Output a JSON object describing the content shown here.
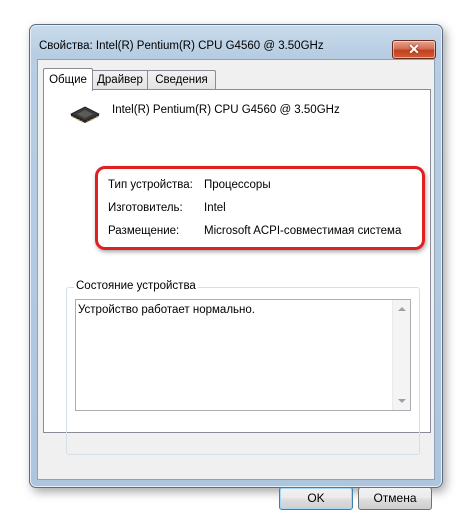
{
  "window": {
    "title": "Свойства: Intel(R) Pentium(R) CPU G4560 @ 3.50GHz",
    "close_glyph": "✕"
  },
  "tabs": [
    {
      "label": "Общие",
      "active": true
    },
    {
      "label": "Драйвер",
      "active": false
    },
    {
      "label": "Сведения",
      "active": false
    }
  ],
  "general": {
    "icon": "cpu-chip-icon",
    "device_name": "Intel(R) Pentium(R) CPU G4560 @ 3.50GHz",
    "properties": [
      {
        "label": "Тип устройства:",
        "value": "Процессоры"
      },
      {
        "label": "Изготовитель:",
        "value": "Intel"
      },
      {
        "label": "Размещение:",
        "value": "Microsoft ACPI-совместимая система"
      }
    ],
    "highlight_color": "#e02020"
  },
  "status": {
    "group_label": "Состояние устройства",
    "text": "Устройство работает нормально."
  },
  "buttons": {
    "ok": "OK",
    "cancel": "Отмена"
  }
}
